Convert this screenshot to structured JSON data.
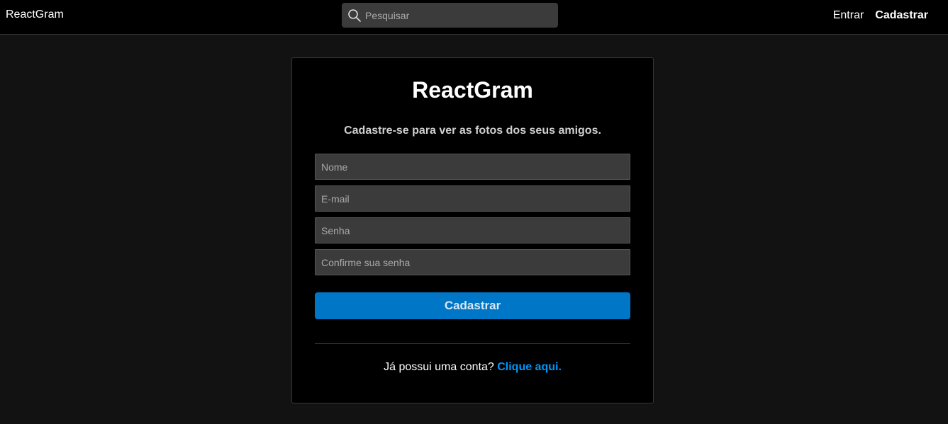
{
  "navbar": {
    "brand": "ReactGram",
    "search_placeholder": "Pesquisar",
    "links": {
      "login": "Entrar",
      "register": "Cadastrar"
    }
  },
  "form": {
    "title": "ReactGram",
    "subtitle": "Cadastre-se para ver as fotos dos seus amigos.",
    "fields": {
      "name_placeholder": "Nome",
      "email_placeholder": "E-mail",
      "password_placeholder": "Senha",
      "confirm_placeholder": "Confirme sua senha"
    },
    "submit_label": "Cadastrar",
    "footer_text": "Já possui uma conta?",
    "footer_link": "Clique aqui."
  },
  "colors": {
    "accent": "#0076c6",
    "link": "#0095f6",
    "background": "#121212"
  },
  "icons": {
    "search": "search-icon"
  }
}
